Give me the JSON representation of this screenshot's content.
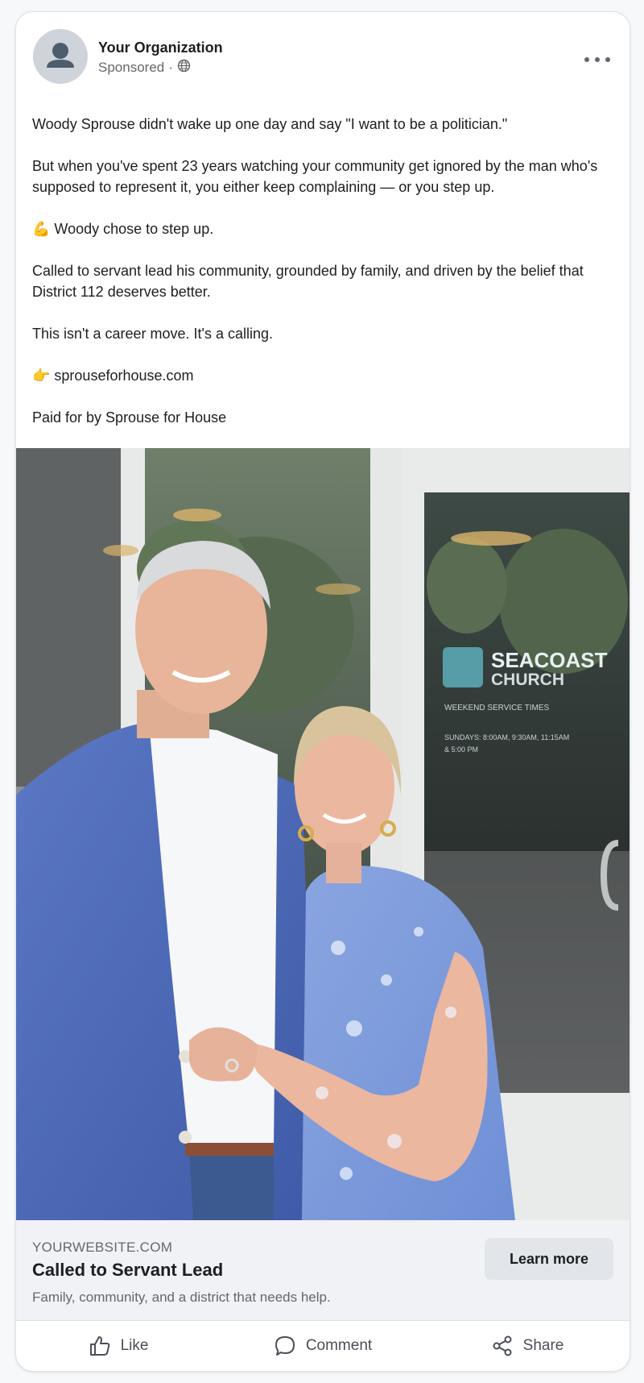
{
  "post": {
    "org_name": "Your Organization",
    "sponsored_label": "Sponsored",
    "separator": "·",
    "audience_icon": "globe-icon",
    "more_icon": "more-horizontal-icon",
    "body": [
      "Woody Sprouse didn't wake up one day and say \"I want to be a politician.\"",
      "But when you've spent 23 years watching your community get ignored by the man who's supposed to represent it, you either keep complaining — or you step up.",
      "💪 Woody chose to step up.",
      "Called to servant lead his community, grounded by family, and driven by the belief that District 112 deserves better.",
      "This isn't a career move. It's a calling.",
      "👉 sprouseforhouse.com",
      "Paid for by Sprouse for House"
    ]
  },
  "photo": {
    "sign_line1": "SEACOAST",
    "sign_line2": "CHURCH",
    "sign_line3": "WEEKEND SERVICE TIMES",
    "sign_line4": "SUNDAYS: 8:00AM, 9:30AM, 11:15AM",
    "sign_line5": "& 5:00 PM"
  },
  "cta": {
    "domain": "YOURWEBSITE.COM",
    "headline": "Called to Servant Lead",
    "description": "Family, community, and a district that needs help.",
    "button_label": "Learn more"
  },
  "actions": {
    "like": "Like",
    "comment": "Comment",
    "share": "Share"
  },
  "colors": {
    "text_primary": "#1c1e21",
    "text_secondary": "#65676b",
    "cta_background": "#f0f2f5",
    "button_background": "#e2e5e9"
  }
}
